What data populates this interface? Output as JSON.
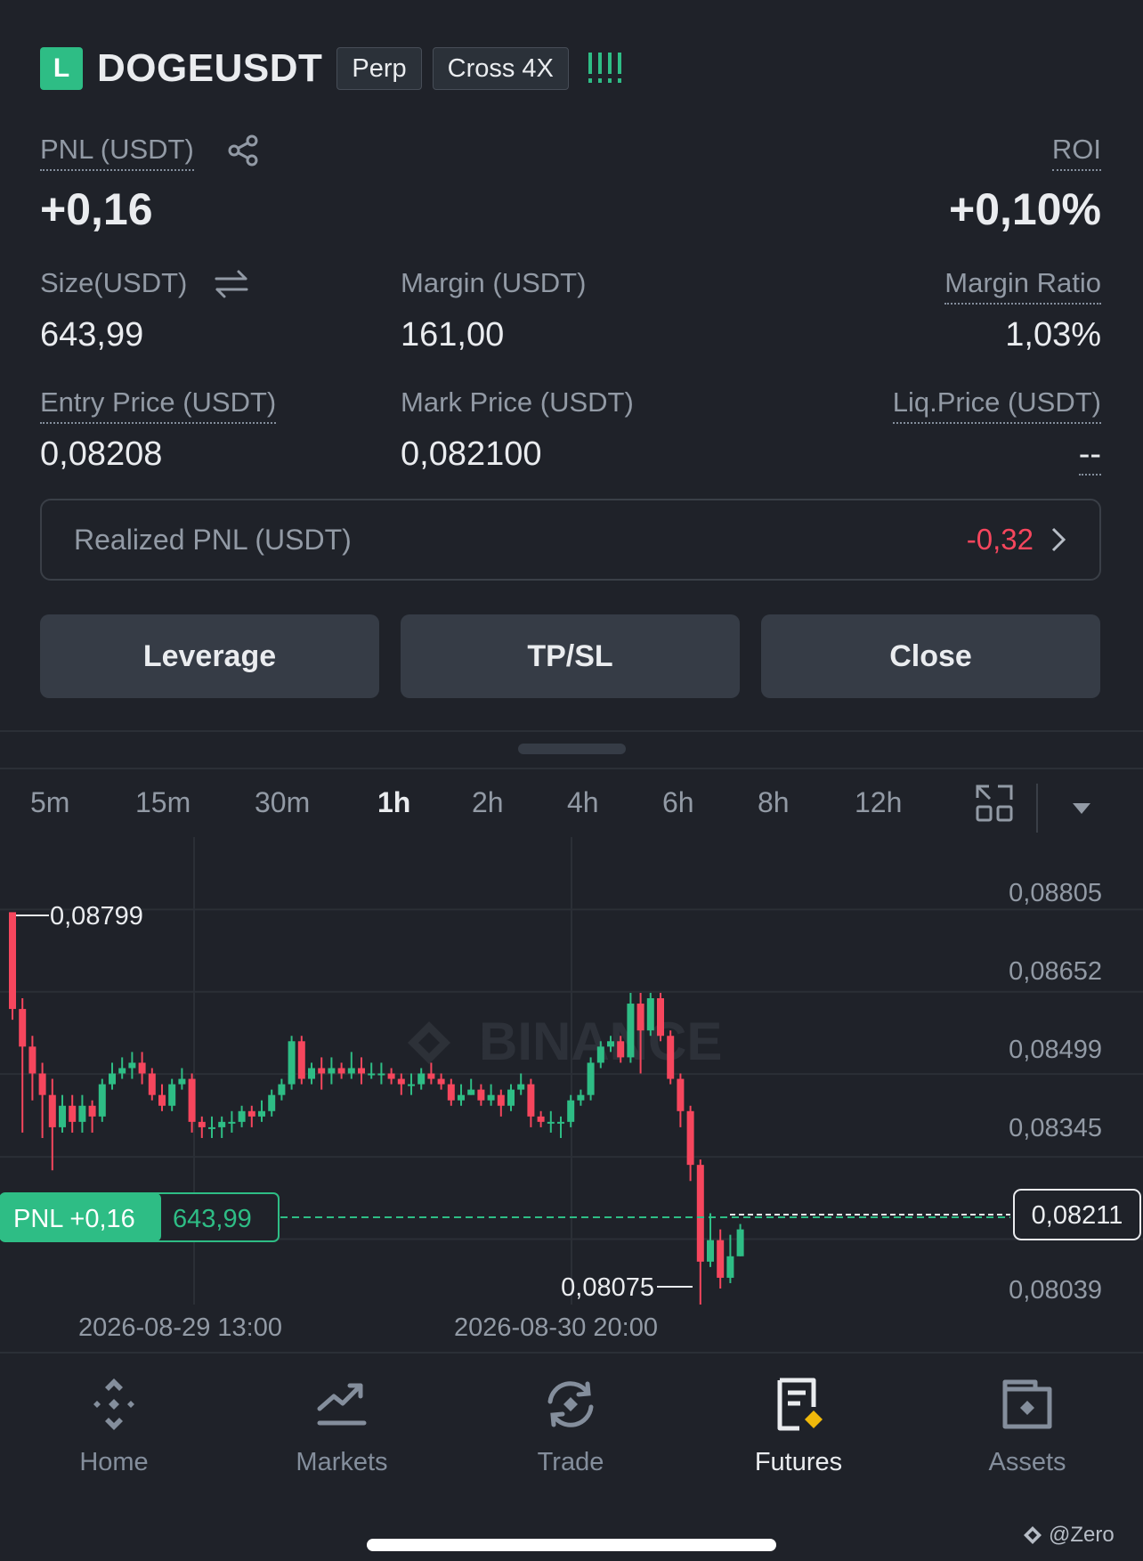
{
  "header": {
    "side_badge": "L",
    "symbol": "DOGEUSDT",
    "contract_tag": "Perp",
    "margin_tag": "Cross 4X"
  },
  "stats": {
    "pnl_label": "PNL (USDT)",
    "pnl_value": "+0,16",
    "roi_label": "ROI",
    "roi_value": "+0,10%",
    "size_label": "Size(USDT)",
    "size_value": "643,99",
    "margin_label": "Margin (USDT)",
    "margin_value": "161,00",
    "margin_ratio_label": "Margin Ratio",
    "margin_ratio_value": "1,03%",
    "entry_label": "Entry Price (USDT)",
    "entry_value": "0,08208",
    "mark_label": "Mark Price (USDT)",
    "mark_value": "0,082100",
    "liq_label": "Liq.Price (USDT)",
    "liq_value": "--"
  },
  "realized": {
    "label": "Realized PNL (USDT)",
    "value": "-0,32"
  },
  "actions": {
    "leverage": "Leverage",
    "tpsl": "TP/SL",
    "close": "Close"
  },
  "intervals": [
    "5m",
    "15m",
    "30m",
    "1h",
    "2h",
    "4h",
    "6h",
    "8h",
    "12h"
  ],
  "active_interval": "1h",
  "chart_data": {
    "type": "candlestick",
    "y_ticks": [
      "0,08805",
      "0,08652",
      "0,08499",
      "0,08345",
      "0,08039"
    ],
    "x_ticks": [
      "2026-08-29 13:00",
      "2026-08-30 20:00"
    ],
    "high_label": "0,08799",
    "low_label": "0,08075",
    "current_price": "0,08211",
    "pnl_tag_label": "PNL +0,16",
    "pnl_tag_size": "643,99",
    "watermark": "BINANCE",
    "ylim": [
      0.08039,
      0.08805
    ],
    "candles": [
      [
        0.088,
        0.0862,
        0.0878,
        0.086
      ],
      [
        0.0862,
        0.0855,
        0.0864,
        0.0839
      ],
      [
        0.0855,
        0.085,
        0.0857,
        0.0845
      ],
      [
        0.085,
        0.0846,
        0.0852,
        0.0838
      ],
      [
        0.0846,
        0.084,
        0.0849,
        0.0832
      ],
      [
        0.084,
        0.0844,
        0.0846,
        0.0839
      ],
      [
        0.0844,
        0.0841,
        0.0846,
        0.0839
      ],
      [
        0.0841,
        0.0844,
        0.0846,
        0.0839
      ],
      [
        0.0844,
        0.0842,
        0.0845,
        0.0839
      ],
      [
        0.0842,
        0.0848,
        0.0849,
        0.0841
      ],
      [
        0.0848,
        0.085,
        0.0852,
        0.0847
      ],
      [
        0.085,
        0.0851,
        0.0853,
        0.0849
      ],
      [
        0.0851,
        0.0852,
        0.0854,
        0.0849
      ],
      [
        0.0852,
        0.085,
        0.0854,
        0.0848
      ],
      [
        0.085,
        0.0846,
        0.0851,
        0.0845
      ],
      [
        0.0846,
        0.0844,
        0.0848,
        0.0843
      ],
      [
        0.0844,
        0.0848,
        0.0849,
        0.0843
      ],
      [
        0.0848,
        0.0849,
        0.0851,
        0.0847
      ],
      [
        0.0849,
        0.0841,
        0.085,
        0.0839
      ],
      [
        0.0841,
        0.084,
        0.0842,
        0.0838
      ],
      [
        0.084,
        0.084,
        0.0842,
        0.0838
      ],
      [
        0.084,
        0.0841,
        0.0842,
        0.0838
      ],
      [
        0.0841,
        0.0841,
        0.0843,
        0.0839
      ],
      [
        0.0841,
        0.0843,
        0.0844,
        0.084
      ],
      [
        0.0843,
        0.0842,
        0.0844,
        0.084
      ],
      [
        0.0842,
        0.0843,
        0.0845,
        0.0841
      ],
      [
        0.0843,
        0.0846,
        0.0847,
        0.0842
      ],
      [
        0.0846,
        0.0848,
        0.0849,
        0.0845
      ],
      [
        0.0848,
        0.0856,
        0.0857,
        0.0847
      ],
      [
        0.0856,
        0.0849,
        0.0857,
        0.0848
      ],
      [
        0.0849,
        0.0851,
        0.0852,
        0.0848
      ],
      [
        0.0851,
        0.085,
        0.0853,
        0.0847
      ],
      [
        0.085,
        0.0851,
        0.0853,
        0.0848
      ],
      [
        0.0851,
        0.085,
        0.0852,
        0.0849
      ],
      [
        0.085,
        0.0851,
        0.0854,
        0.0849
      ],
      [
        0.0851,
        0.085,
        0.0853,
        0.0848
      ],
      [
        0.085,
        0.085,
        0.0852,
        0.0849
      ],
      [
        0.085,
        0.085,
        0.0852,
        0.0848
      ],
      [
        0.085,
        0.0849,
        0.0851,
        0.0848
      ],
      [
        0.0849,
        0.0848,
        0.085,
        0.0846
      ],
      [
        0.0848,
        0.0848,
        0.085,
        0.0846
      ],
      [
        0.0848,
        0.085,
        0.0851,
        0.0847
      ],
      [
        0.085,
        0.0849,
        0.0852,
        0.0848
      ],
      [
        0.0849,
        0.0848,
        0.085,
        0.0847
      ],
      [
        0.0848,
        0.0845,
        0.0849,
        0.0844
      ],
      [
        0.0845,
        0.0846,
        0.0848,
        0.0844
      ],
      [
        0.0846,
        0.0847,
        0.0849,
        0.0846
      ],
      [
        0.0847,
        0.0845,
        0.0848,
        0.0844
      ],
      [
        0.0845,
        0.0846,
        0.0848,
        0.0844
      ],
      [
        0.0846,
        0.0844,
        0.0847,
        0.0842
      ],
      [
        0.0844,
        0.0847,
        0.0848,
        0.0843
      ],
      [
        0.0847,
        0.0848,
        0.085,
        0.0846
      ],
      [
        0.0848,
        0.0842,
        0.0849,
        0.084
      ],
      [
        0.0842,
        0.0841,
        0.0843,
        0.084
      ],
      [
        0.0841,
        0.0841,
        0.0843,
        0.0839
      ],
      [
        0.0841,
        0.0841,
        0.0842,
        0.0838
      ],
      [
        0.0841,
        0.0845,
        0.0846,
        0.084
      ],
      [
        0.0845,
        0.0846,
        0.0847,
        0.0844
      ],
      [
        0.0846,
        0.0852,
        0.0853,
        0.0845
      ],
      [
        0.0852,
        0.0855,
        0.0856,
        0.0851
      ],
      [
        0.0855,
        0.0856,
        0.0857,
        0.0854
      ],
      [
        0.0856,
        0.0853,
        0.0857,
        0.0852
      ],
      [
        0.0853,
        0.0863,
        0.0865,
        0.0852
      ],
      [
        0.0863,
        0.0858,
        0.0865,
        0.085
      ],
      [
        0.0858,
        0.0864,
        0.0865,
        0.0857
      ],
      [
        0.0864,
        0.0857,
        0.0865,
        0.0856
      ],
      [
        0.0857,
        0.0849,
        0.0858,
        0.0848
      ],
      [
        0.0849,
        0.0843,
        0.085,
        0.084
      ],
      [
        0.0843,
        0.0833,
        0.0844,
        0.083
      ],
      [
        0.0833,
        0.0815,
        0.0834,
        0.0807
      ],
      [
        0.0815,
        0.0819,
        0.0824,
        0.0814
      ],
      [
        0.0819,
        0.0812,
        0.0821,
        0.081
      ],
      [
        0.0812,
        0.0816,
        0.082,
        0.0811
      ],
      [
        0.0816,
        0.0821,
        0.0822,
        0.0816
      ]
    ]
  },
  "nav": [
    {
      "label": "Home",
      "icon": "binance-home-icon",
      "active": false
    },
    {
      "label": "Markets",
      "icon": "markets-chart-icon",
      "active": false
    },
    {
      "label": "Trade",
      "icon": "trade-exchange-icon",
      "active": false
    },
    {
      "label": "Futures",
      "icon": "futures-document-icon",
      "active": true
    },
    {
      "label": "Assets",
      "icon": "wallet-icon",
      "active": false
    }
  ],
  "footer_mark": "@Zero",
  "colors": {
    "up": "#2ebd85",
    "down": "#f6465d",
    "accent": "#f0b90b",
    "bg": "#1f2229"
  }
}
